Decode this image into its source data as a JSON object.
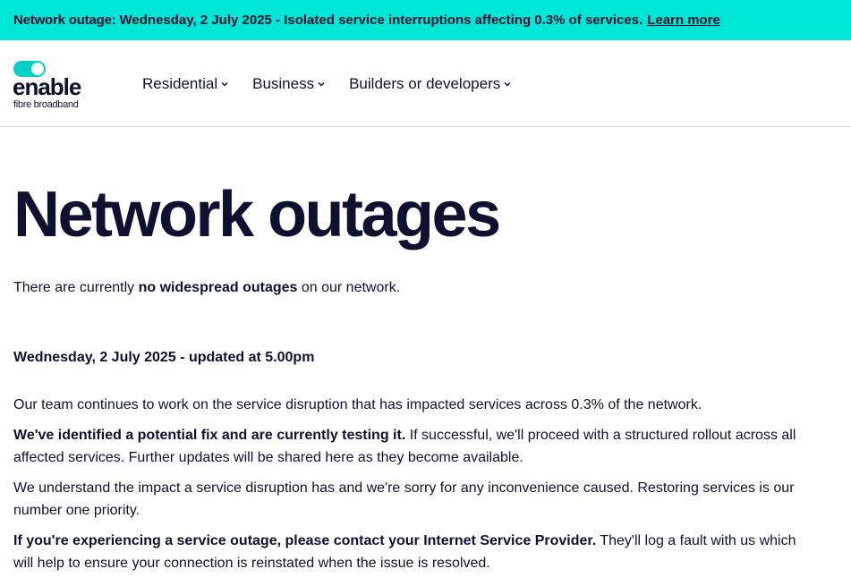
{
  "alert": {
    "title": "Network outage:",
    "text": "Wednesday, 2 July 2025 - Isolated service interruptions affecting 0.3% of services.",
    "link": "Learn more"
  },
  "logo": {
    "word": "enable",
    "sub": "fibre broadband"
  },
  "nav": {
    "items": [
      {
        "label": "Residential"
      },
      {
        "label": "Business"
      },
      {
        "label": "Builders or developers"
      }
    ]
  },
  "main": {
    "title": "Network outages",
    "status": {
      "before": "There are currently ",
      "bold": "no widespread outages",
      "after": " on our network."
    },
    "update_heading": "Wednesday, 2 July 2025 - updated at 5.00pm",
    "paragraphs": {
      "p1": "Our team continues to work on the service disruption that has impacted services across 0.3% of the network.",
      "p2_bold": "We've identified a potential fix and are currently testing it.",
      "p2_rest": " If successful, we'll proceed with a structured rollout across all affected services. Further updates will be shared here as they become available.",
      "p3": "We understand the impact a service disruption has and we're sorry for any inconvenience caused. Restoring services is our number one priority.",
      "p4_bold": "If you're experiencing a service outage, please contact your Internet Service Provider.",
      "p4_rest": " They'll log a fault with us which will help to ensure your connection is reinstated when the issue is resolved."
    }
  },
  "colors": {
    "alert_bg": "#00e6d6",
    "brand_teal": "#00d1c4",
    "text_navy": "#0e1230"
  }
}
